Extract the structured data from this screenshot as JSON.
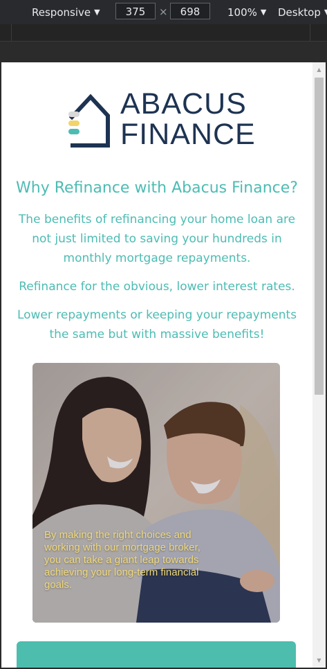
{
  "devtools": {
    "device_mode": "Responsive",
    "width": "375",
    "separator": "×",
    "height": "698",
    "zoom": "100%",
    "device_type": "Desktop"
  },
  "page": {
    "logo": {
      "line1": "ABACUS",
      "line2": "FINANCE",
      "brand_color": "#1e3352",
      "dot_colors": [
        "#d9d9d9",
        "#f2d46b",
        "#4cbcb3"
      ]
    },
    "heading": "Why Refinance with Abacus Finance?",
    "paragraphs": [
      "The benefits of refinancing your home loan are not just limited to saving your hundreds in monthly mortgage repayments.",
      "Refinance for the obvious, lower interest rates.",
      "Lower repayments or keeping your repayments the same but with massive benefits!"
    ],
    "photo_caption": "By making the right choices and working with our mortgage broker, you can take a giant leap towards achieving your long-term financial goals.",
    "accent_color": "#4cbcb3",
    "cta_color": "#4dbdad"
  }
}
